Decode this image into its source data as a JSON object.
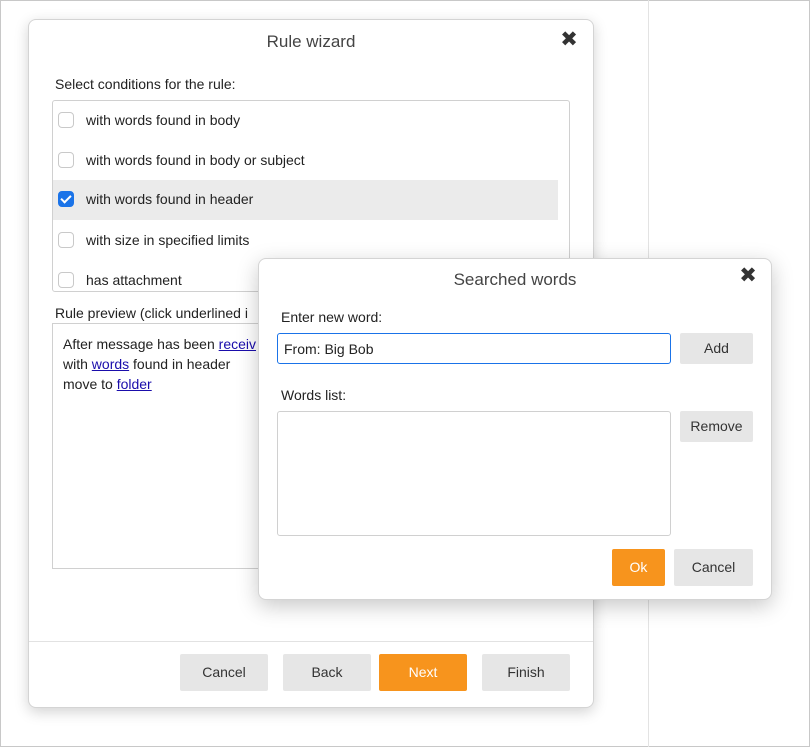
{
  "rule_wizard": {
    "title": "Rule wizard",
    "close_label": "✖",
    "conditions_label": "Select conditions for the rule:",
    "conditions": [
      {
        "label": "with words found in body",
        "checked": false
      },
      {
        "label": "with words found in body or subject",
        "checked": false
      },
      {
        "label": "with words found in header",
        "checked": true
      },
      {
        "label": "with size in specified limits",
        "checked": false
      },
      {
        "label": "has attachment",
        "checked": false
      }
    ],
    "preview_label": "Rule preview (click underlined i",
    "preview": {
      "line1_text": "After message has been ",
      "line1_link": "receiv",
      "line2_text": "with ",
      "line2_link": "words",
      "line2_rest": " found in header",
      "line3_text": "move to ",
      "line3_link": "folder"
    },
    "buttons": {
      "cancel": "Cancel",
      "back": "Back",
      "next": "Next",
      "finish": "Finish"
    }
  },
  "searched_words": {
    "title": "Searched words",
    "close_label": "✖",
    "new_word_label": "Enter new word:",
    "new_word_value": "From: Big Bob",
    "add_button": "Add",
    "words_list_label": "Words list:",
    "words": [],
    "remove_button": "Remove",
    "ok_button": "Ok",
    "cancel_button": "Cancel"
  },
  "colors": {
    "accent": "#f7941d",
    "checkbox": "#1a73e8",
    "focus_border": "#1a73e8",
    "link": "#1a0dab"
  }
}
